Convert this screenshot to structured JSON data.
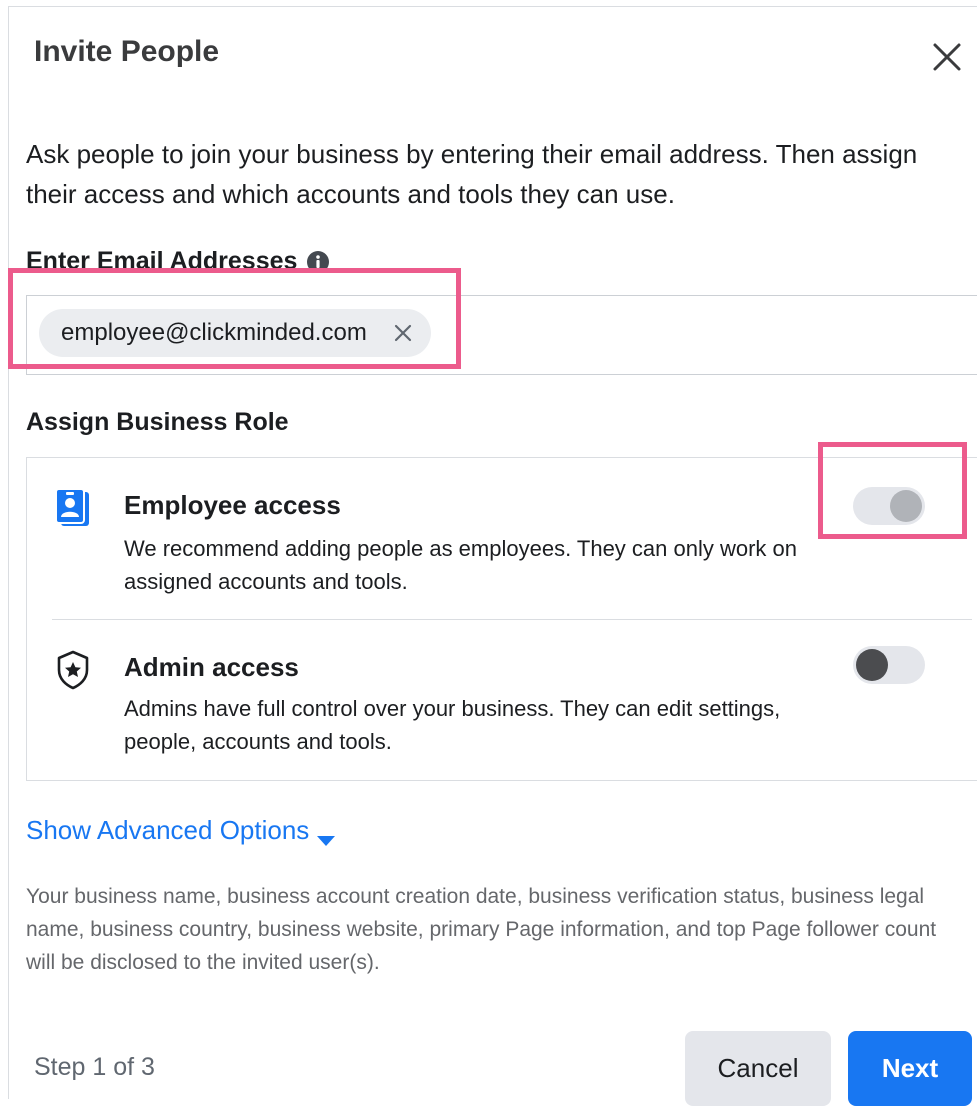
{
  "dialog": {
    "title": "Invite People",
    "intro": "Ask people to join your business by entering their email address. Then assign their access and which accounts and tools they can use.",
    "email_label": "Enter Email Addresses",
    "email_chip": "employee@clickminded.com",
    "role_label": "Assign Business Role",
    "roles": [
      {
        "title": "Employee access",
        "description": "We recommend adding people as employees. They can only work on assigned accounts and tools.",
        "icon": "id-badge-icon",
        "toggle_on": false
      },
      {
        "title": "Admin access",
        "description": "Admins have full control over your business. They can edit settings, people, accounts and tools.",
        "icon": "shield-star-icon",
        "toggle_on": false
      }
    ],
    "advanced_label": "Show Advanced Options",
    "disclosure": "Your business name, business account creation date, business verification status, business legal name, business country, business website, primary Page information, and top Page follower count will be disclosed to the invited user(s).",
    "step": "Step 1 of 3",
    "cancel_label": "Cancel",
    "next_label": "Next"
  },
  "colors": {
    "accent": "#1877f2",
    "highlight": "#ec5b8c",
    "secondary_text": "#65676b"
  }
}
